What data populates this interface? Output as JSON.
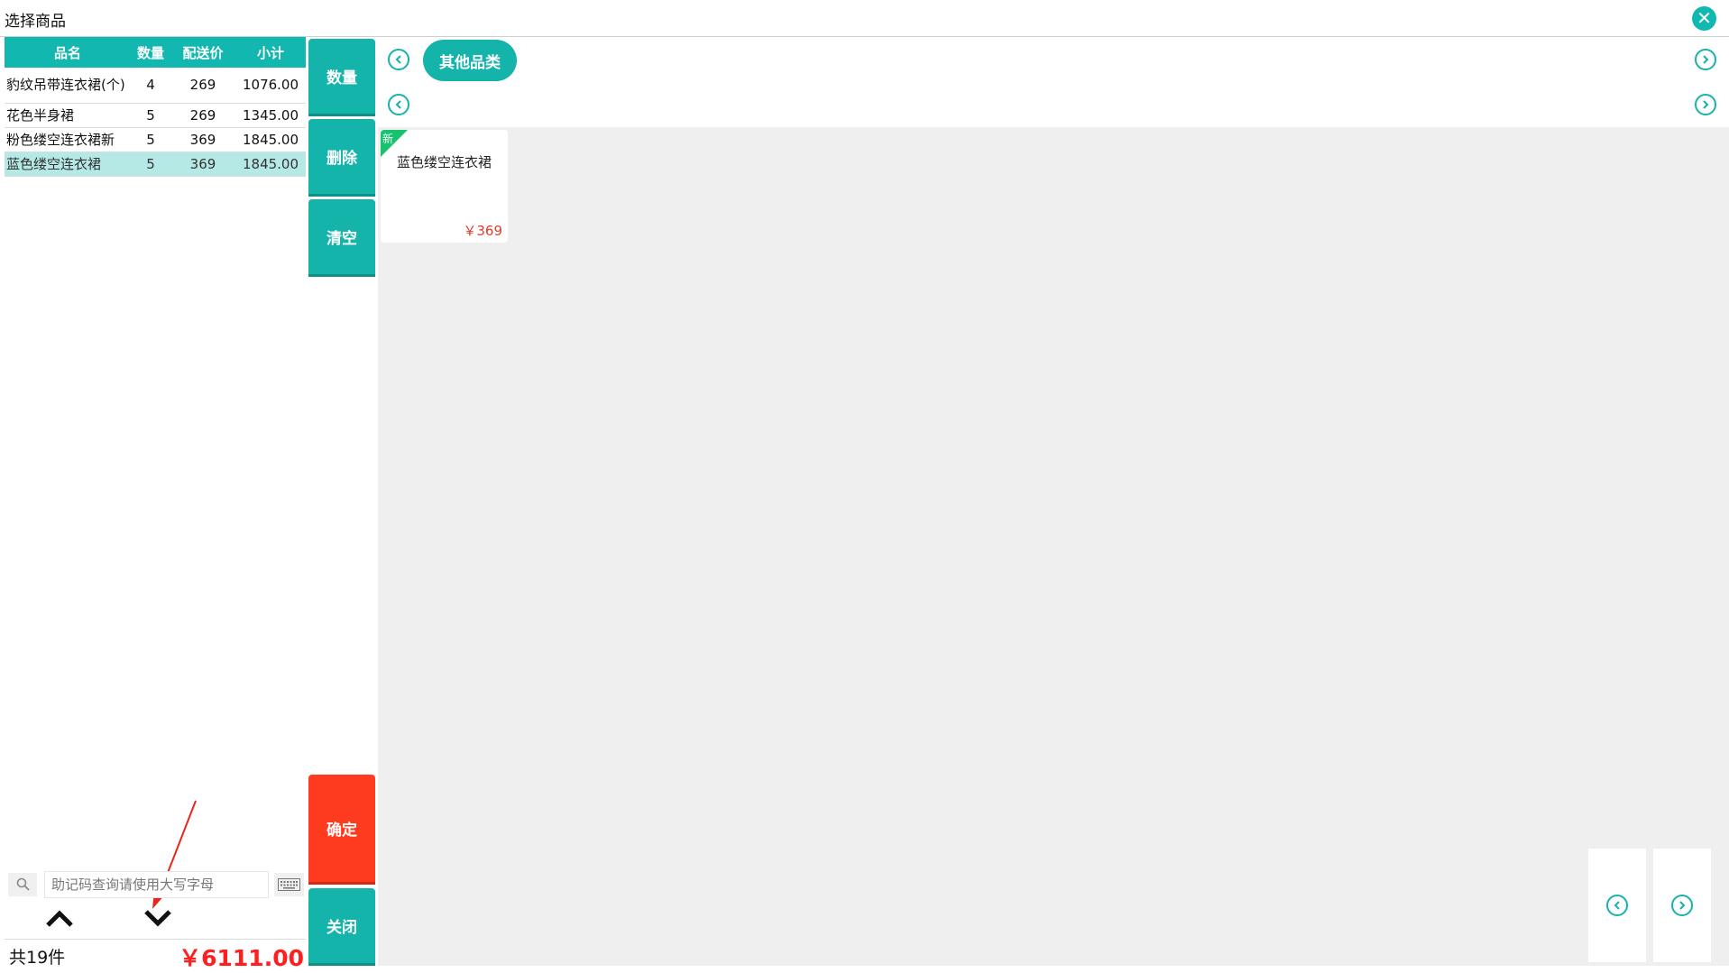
{
  "window": {
    "title": "选择商品"
  },
  "order": {
    "columns": [
      "品名",
      "数量",
      "配送价",
      "小计"
    ],
    "rows": [
      {
        "name": "豹纹吊带连衣裙(个)",
        "qty": "4",
        "price": "269",
        "subtotal": "1076.00"
      },
      {
        "name": "花色半身裙",
        "qty": "5",
        "price": "269",
        "subtotal": "1345.00"
      },
      {
        "name": "粉色缕空连衣裙新",
        "qty": "5",
        "price": "369",
        "subtotal": "1845.00"
      },
      {
        "name": "蓝色缕空连衣裙",
        "qty": "5",
        "price": "369",
        "subtotal": "1845.00"
      }
    ],
    "selected_row": 3
  },
  "search": {
    "placeholder": "助记码查询请使用大写字母"
  },
  "footer": {
    "count": "共19件",
    "total": "￥6111.00"
  },
  "actions": {
    "qty": "数量",
    "delete": "删除",
    "clear": "清空",
    "confirm": "确定",
    "close": "关闭"
  },
  "category": {
    "tab": "其他品类"
  },
  "products": [
    {
      "tag": "新",
      "name": "蓝色缕空连衣裙",
      "price": "￥369"
    }
  ],
  "colors": {
    "accent": "#15b4ab",
    "confirm": "#ff3b1f",
    "price": "#e33b2b",
    "total": "#ff1f1f",
    "new_tag": "#18c26e",
    "selected_row": "#b5e9e6"
  },
  "icons": [
    "close-icon",
    "search-icon",
    "keyboard-icon",
    "chevron-up-icon",
    "chevron-down-icon",
    "chevron-left-icon",
    "chevron-right-icon"
  ]
}
